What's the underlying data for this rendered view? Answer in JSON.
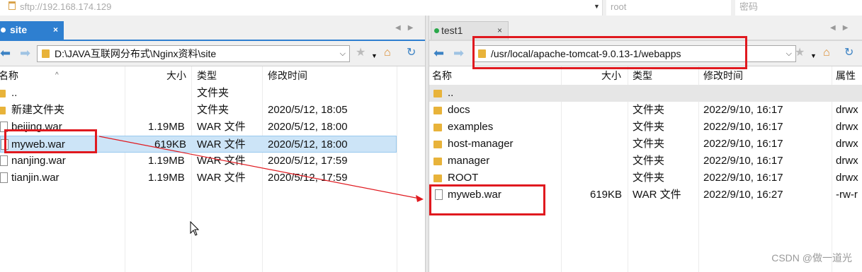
{
  "topbar": {
    "connection_url": "sftp://192.168.174.129",
    "user_placeholder": "root",
    "password_placeholder": "密码"
  },
  "left": {
    "tab_label": "site",
    "tab_close": "×",
    "path": "D:\\JAVA互联网分布式\\Nginx资料\\site",
    "headers": {
      "name": "名称",
      "size": "大小",
      "type": "类型",
      "modified": "修改时间"
    },
    "rows": [
      {
        "name": "..",
        "size": "",
        "type": "文件夹",
        "modified": "",
        "icon": "folder-icon"
      },
      {
        "name": "新建文件夹",
        "size": "",
        "type": "文件夹",
        "modified": "2020/5/12, 18:05",
        "icon": "folder-icon"
      },
      {
        "name": "beijing.war",
        "size": "1.19MB",
        "type": "WAR 文件",
        "modified": "2020/5/12, 18:00",
        "icon": "file-icon"
      },
      {
        "name": "myweb.war",
        "size": "619KB",
        "type": "WAR 文件",
        "modified": "2020/5/12, 18:00",
        "icon": "file-icon",
        "selected": true
      },
      {
        "name": "nanjing.war",
        "size": "1.19MB",
        "type": "WAR 文件",
        "modified": "2020/5/12, 17:59",
        "icon": "file-icon"
      },
      {
        "name": "tianjin.war",
        "size": "1.19MB",
        "type": "WAR 文件",
        "modified": "2020/5/12, 17:59",
        "icon": "file-icon"
      }
    ]
  },
  "right": {
    "tab_label": "test1",
    "tab_close": "×",
    "path": "/usr/local/apache-tomcat-9.0.13-1/webapps",
    "headers": {
      "name": "名称",
      "size": "大小",
      "type": "类型",
      "modified": "修改时间",
      "attrs": "属性"
    },
    "rows": [
      {
        "name": "..",
        "size": "",
        "type": "",
        "modified": "",
        "attrs": "",
        "icon": "folder-icon"
      },
      {
        "name": "docs",
        "size": "",
        "type": "文件夹",
        "modified": "2022/9/10, 16:17",
        "attrs": "drwx",
        "icon": "folder-icon"
      },
      {
        "name": "examples",
        "size": "",
        "type": "文件夹",
        "modified": "2022/9/10, 16:17",
        "attrs": "drwx",
        "icon": "folder-icon"
      },
      {
        "name": "host-manager",
        "size": "",
        "type": "文件夹",
        "modified": "2022/9/10, 16:17",
        "attrs": "drwx",
        "icon": "folder-icon"
      },
      {
        "name": "manager",
        "size": "",
        "type": "文件夹",
        "modified": "2022/9/10, 16:17",
        "attrs": "drwx",
        "icon": "folder-icon"
      },
      {
        "name": "ROOT",
        "size": "",
        "type": "文件夹",
        "modified": "2022/9/10, 16:17",
        "attrs": "drwx",
        "icon": "folder-icon"
      },
      {
        "name": "myweb.war",
        "size": "619KB",
        "type": "WAR 文件",
        "modified": "2022/9/10, 16:27",
        "attrs": "-rw-r",
        "icon": "file-icon"
      }
    ]
  },
  "watermark": "CSDN @做一道光",
  "colors": {
    "accent": "#2e7fd0",
    "highlight": "#e0191f",
    "folder": "#e8b33a",
    "selected_row": "#cce4f7"
  }
}
